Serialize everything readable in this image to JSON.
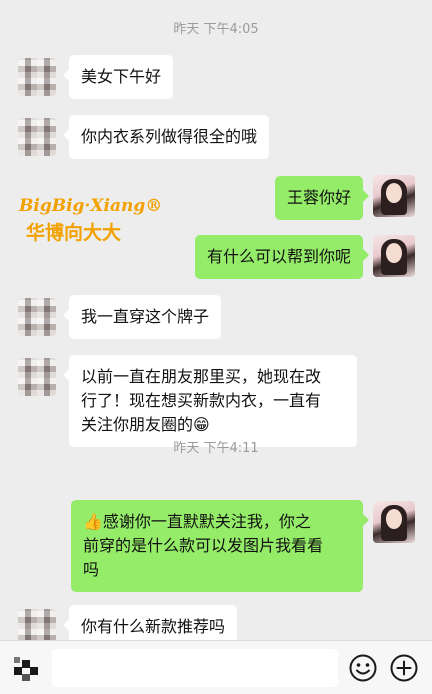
{
  "conversation": {
    "timestamp_1": "昨天 下午4:05",
    "timestamp_2": "昨天 下午4:11",
    "messages": [
      {
        "side": "in",
        "text": "美女下午好"
      },
      {
        "side": "in",
        "text": "你内衣系列做得很全的哦"
      },
      {
        "side": "out",
        "text": "王蓉你好"
      },
      {
        "side": "out",
        "text": "有什么可以帮到你呢"
      },
      {
        "side": "in",
        "text": "我一直穿这个牌子"
      },
      {
        "side": "in",
        "lines": [
          "以前一直在朋友那里买，她现在改",
          "行了！现在想买新款内衣，一直有",
          "关注你朋友圈的😁"
        ]
      },
      {
        "side": "out",
        "lines": [
          "👍感谢你一直默默关注我，你之",
          "前穿的是什么款可以发图片我看看",
          "吗"
        ]
      },
      {
        "side": "in",
        "text": "你有什么新款推荐吗"
      }
    ]
  },
  "watermark": {
    "brand_en": "BigBig·Xiang®",
    "brand_cn": "华博向大大",
    "color": "#f2a100"
  },
  "input_bar": {
    "placeholder": "",
    "voice_icon": "voice-toggle-icon",
    "emoji_icon": "emoji-icon",
    "plus_icon": "plus-icon"
  },
  "colors": {
    "background": "#ededed",
    "incoming_bubble": "#ffffff",
    "outgoing_bubble": "#95ec69",
    "timestamp": "#9b9b9b"
  }
}
